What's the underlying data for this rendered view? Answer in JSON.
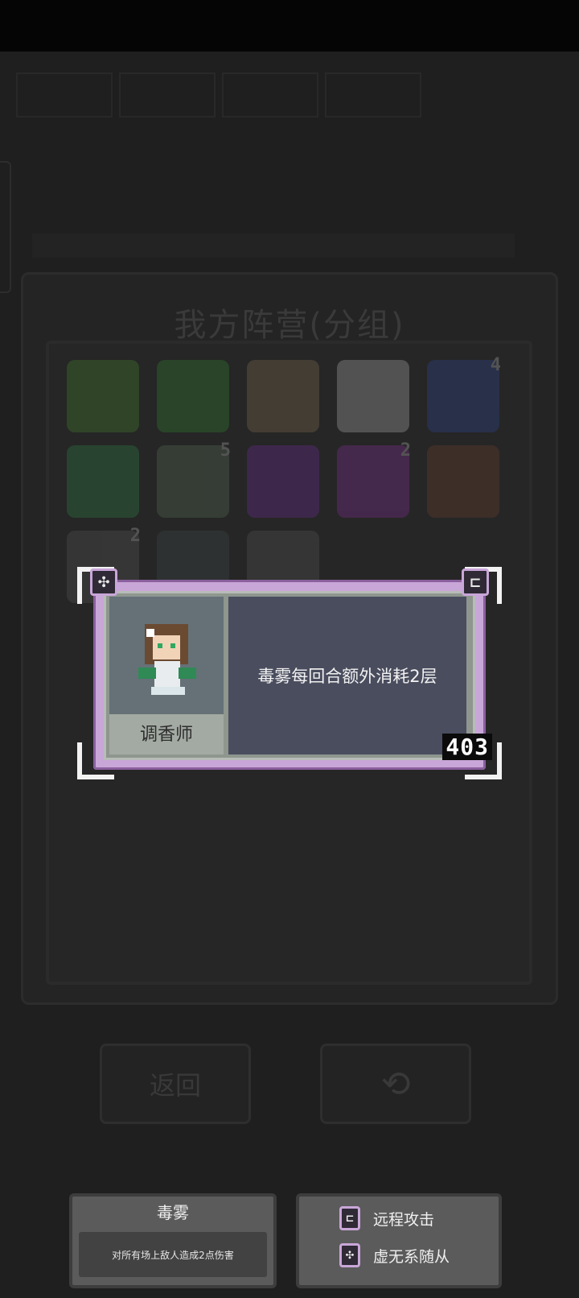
{
  "panel": {
    "title": "我方阵营(分组)"
  },
  "roster": [
    {
      "name": "slot-1",
      "color": "#3f6b2d",
      "badge": ""
    },
    {
      "name": "slot-2",
      "color": "#2f6b2f",
      "badge": ""
    },
    {
      "name": "slot-3",
      "color": "#6b5a48",
      "badge": ""
    },
    {
      "name": "slot-4",
      "color": "#8a8a8a",
      "badge": ""
    },
    {
      "name": "slot-5",
      "color": "#2d3e77",
      "badge": "4"
    },
    {
      "name": "slot-6",
      "color": "#2d6b3e",
      "badge": ""
    },
    {
      "name": "slot-7",
      "color": "#4a5a4a",
      "badge": "5"
    },
    {
      "name": "slot-8",
      "color": "#5a2d7a",
      "badge": ""
    },
    {
      "name": "slot-9",
      "color": "#6b2d7a",
      "badge": "2"
    },
    {
      "name": "slot-10",
      "color": "#5a3a2d",
      "badge": ""
    },
    {
      "name": "slot-11",
      "color": "#4a4a4a",
      "badge": "2"
    },
    {
      "name": "slot-12",
      "color": "#3a4040",
      "badge": ""
    },
    {
      "name": "slot-13",
      "color": "#4a4a4a",
      "badge": ""
    }
  ],
  "dialog": {
    "unit_name": "调香师",
    "description": "毒雾每回合额外消耗2层",
    "cost": "403"
  },
  "buttons": {
    "back": "返回",
    "refresh_icon": "refresh-icon"
  },
  "skill_card": {
    "title": "毒雾",
    "description": "对所有场上敌人造成2点伤害"
  },
  "tags": [
    {
      "label": "远程攻击",
      "icon": "ranged-icon"
    },
    {
      "label": "虚无系随从",
      "icon": "void-icon"
    }
  ]
}
